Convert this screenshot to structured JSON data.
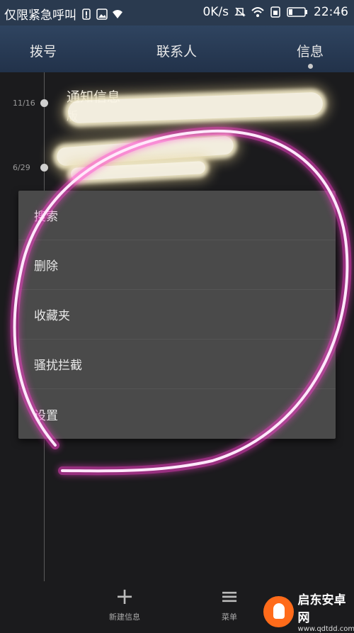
{
  "status_bar": {
    "carrier_text": "仅限紧急呼叫",
    "speed": "0K/s",
    "time": "22:46"
  },
  "tabs": [
    {
      "label": "拨号"
    },
    {
      "label": "联系人"
    },
    {
      "label": "信息",
      "active": true
    }
  ],
  "conversations": [
    {
      "date": "11/16",
      "title": "通知信息",
      "preview": "版"
    },
    {
      "date": "6/29"
    }
  ],
  "menu": {
    "items": [
      {
        "label": "搜索"
      },
      {
        "label": "删除"
      },
      {
        "label": "收藏夹"
      },
      {
        "label": "骚扰拦截"
      },
      {
        "label": "设置"
      }
    ]
  },
  "bottom_bar": {
    "new_message_label": "新建信息",
    "menu_label": "菜单"
  },
  "watermark": {
    "name": "启东安卓网",
    "url": "www.qdtdd.com"
  },
  "colors": {
    "header": "#2f4460",
    "menu_bg": "#4a4a4a",
    "annotation": "#ff3fd0",
    "watermark_orange": "#ff6b1a"
  }
}
